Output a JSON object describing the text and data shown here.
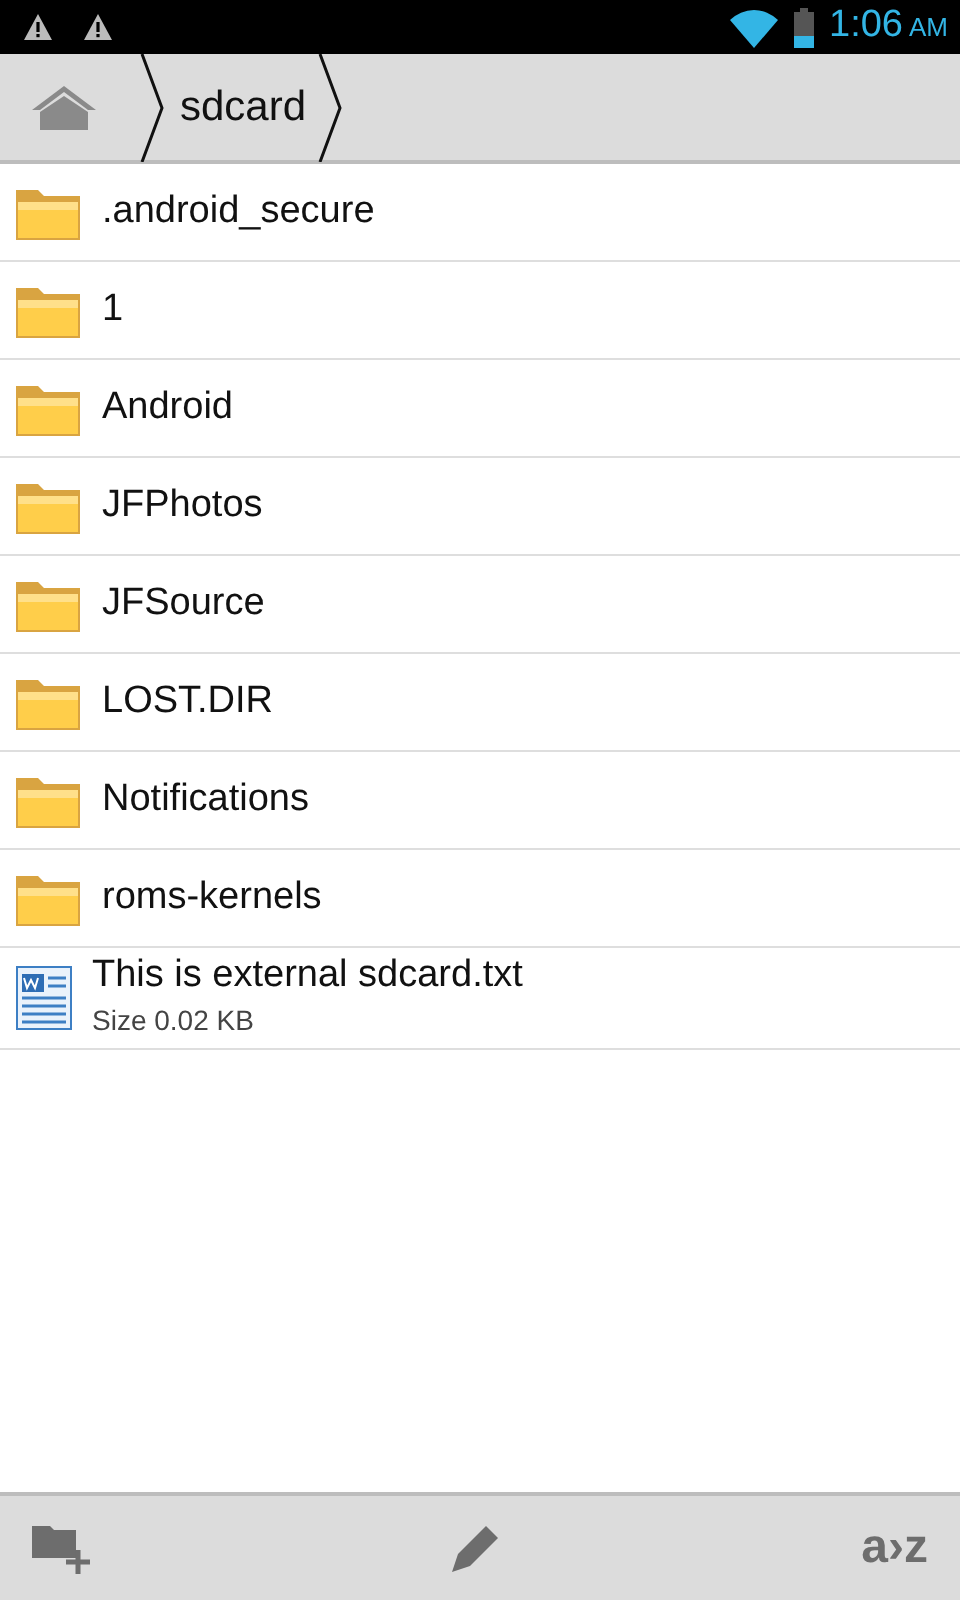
{
  "status_bar": {
    "time": "1:06",
    "meridiem": "AM",
    "notifications": [
      {
        "kind": "warning"
      },
      {
        "kind": "warning"
      }
    ]
  },
  "breadcrumb": [
    {
      "kind": "home"
    },
    {
      "kind": "folder",
      "label": "sdcard"
    }
  ],
  "files": [
    {
      "kind": "folder",
      "name": ".android_secure"
    },
    {
      "kind": "folder",
      "name": "1"
    },
    {
      "kind": "folder",
      "name": "Android"
    },
    {
      "kind": "folder",
      "name": "JFPhotos"
    },
    {
      "kind": "folder",
      "name": "JFSource"
    },
    {
      "kind": "folder",
      "name": "LOST.DIR"
    },
    {
      "kind": "folder",
      "name": "Notifications"
    },
    {
      "kind": "folder",
      "name": "roms-kernels"
    },
    {
      "kind": "document",
      "name": "This is external sdcard.txt",
      "detail": "Size 0.02 KB"
    }
  ],
  "toolbar": [
    {
      "kind": "new-folder"
    },
    {
      "kind": "edit"
    },
    {
      "kind": "sort",
      "label": "a›z"
    }
  ]
}
